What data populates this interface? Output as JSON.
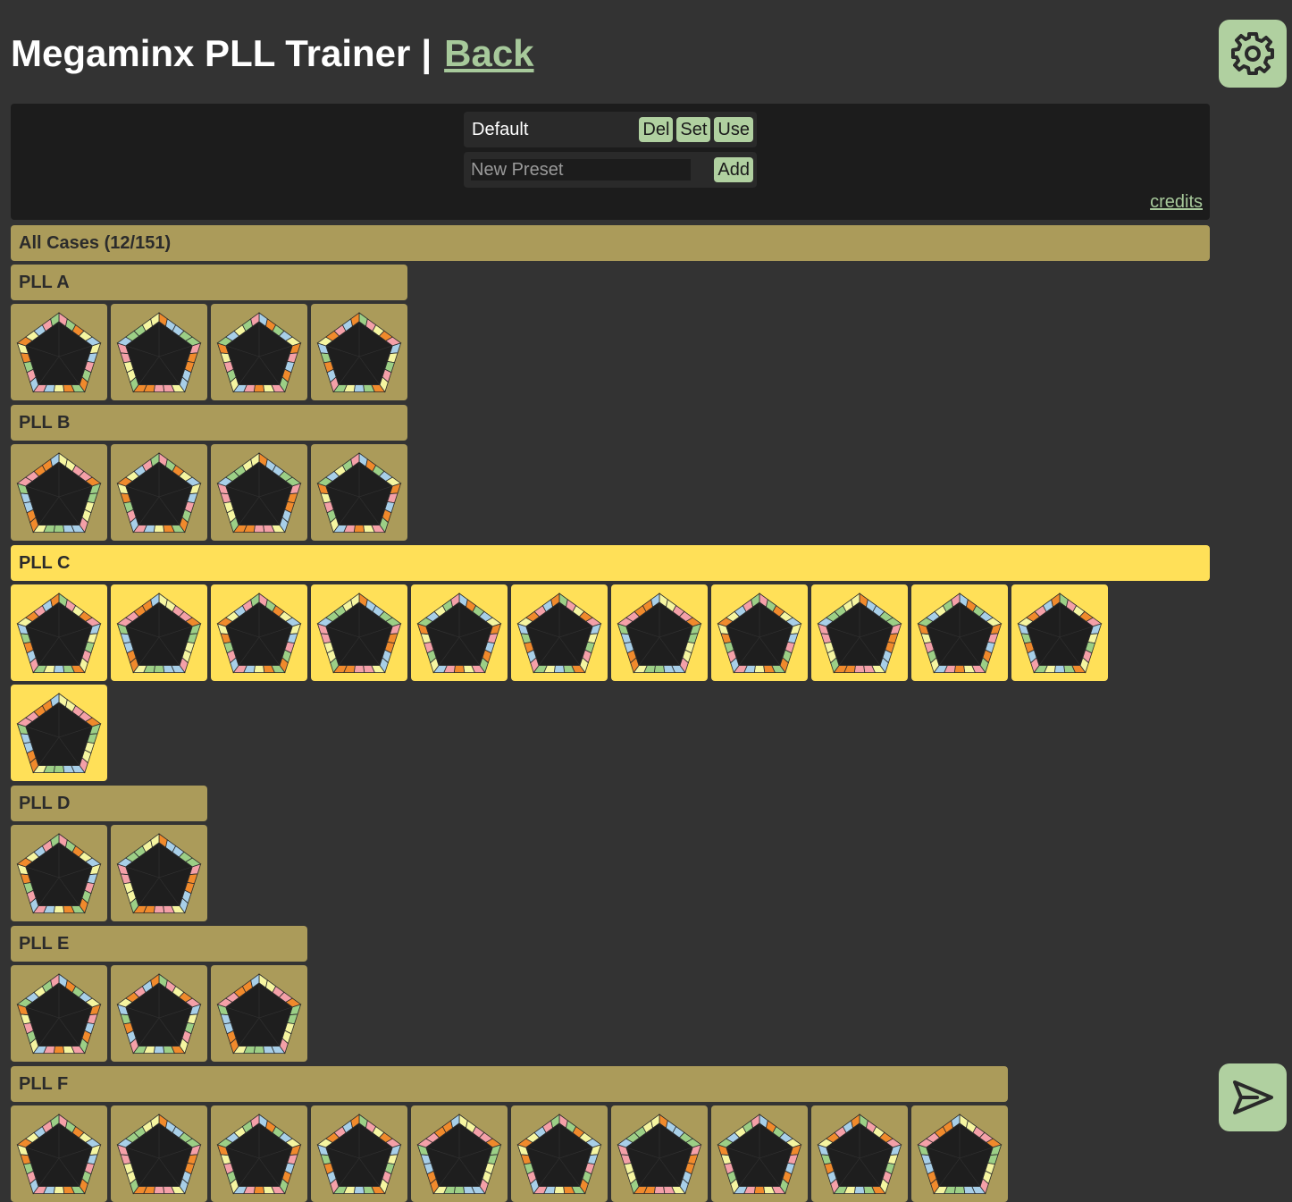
{
  "header": {
    "title": "Megaminx PLL Trainer",
    "separator": "|",
    "back_label": "Back"
  },
  "presets": {
    "current": "Default",
    "del_label": "Del",
    "set_label": "Set",
    "use_label": "Use",
    "new_placeholder": "New Preset",
    "add_label": "Add"
  },
  "credits_label": "credits",
  "all_cases_label": "All Cases (12/151)",
  "groups": [
    {
      "label": "PLL A",
      "count": 4,
      "selected": false
    },
    {
      "label": "PLL B",
      "count": 4,
      "selected": false
    },
    {
      "label": "PLL C",
      "count": 12,
      "selected": true
    },
    {
      "label": "PLL D",
      "count": 2,
      "selected": false
    },
    {
      "label": "PLL E",
      "count": 3,
      "selected": false
    },
    {
      "label": "PLL F",
      "count": 10,
      "selected": false
    }
  ],
  "sticker_colors": [
    "#f5f5a0",
    "#a8cfe8",
    "#f4a0a8",
    "#9ccf86",
    "#f08a2c"
  ],
  "colors": {
    "accent": "#b0d0a0",
    "tile": "#ab9b5a",
    "tile_selected": "#ffe058",
    "background": "#333333",
    "panel": "#1c1c1c"
  },
  "icons": {
    "settings": "gear-icon",
    "submit": "send-icon"
  }
}
